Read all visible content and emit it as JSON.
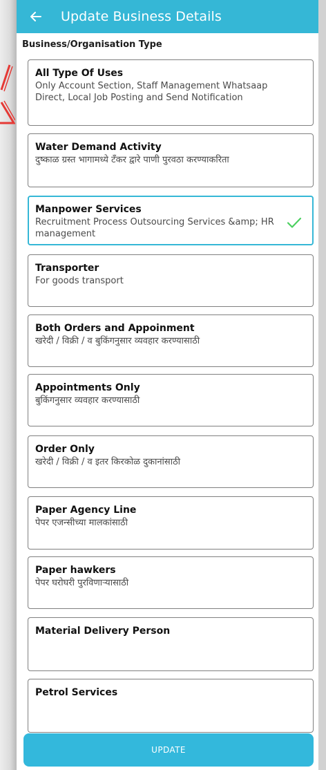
{
  "header": {
    "title": "Update Business Details",
    "back_icon": "arrow-left-icon"
  },
  "section": {
    "label": "Business/Organisation Type"
  },
  "business_types": [
    {
      "title": "All Type Of Uses",
      "description": "Only Account Section, Staff Management Whatsaap Direct, Local Job Posting and Send Notification",
      "selected": false
    },
    {
      "title": "Water Demand Activity",
      "description": "दुष्काळ ग्रस्त भागामध्ये टँकर द्वारे पाणी पुरवठा करण्याकरिता",
      "selected": false
    },
    {
      "title": "Manpower Services",
      "description": "Recruitment Process Outsourcing Services &amp; HR management",
      "selected": true
    },
    {
      "title": "Transporter",
      "description": "For goods transport",
      "selected": false
    },
    {
      "title": "Both Orders and Appoinment",
      "description": "खरेदी / विक्री / व बुकिंगनुसार व्यवहार करण्यासाठी",
      "selected": false
    },
    {
      "title": "Appointments Only",
      "description": "बुकिंगनुसार व्यवहार करण्यासाठी",
      "selected": false
    },
    {
      "title": "Order Only",
      "description": "खरेदी / विक्री / व इतर किरकोळ दुकानांसाठी",
      "selected": false
    },
    {
      "title": "Paper Agency Line",
      "description": "पेपर एजन्सीच्या मालकांसाठी",
      "selected": false
    },
    {
      "title": "Paper hawkers",
      "description": "पेपर घरोघरी पुरविणाऱ्यासाठी",
      "selected": false
    },
    {
      "title": "Material Delivery Person",
      "description": "",
      "selected": false
    },
    {
      "title": "Petrol Services",
      "description": "",
      "selected": false
    }
  ],
  "footer": {
    "update_label": "UPDATE"
  },
  "colors": {
    "accent": "#35b7d6",
    "check": "#4cd060",
    "card_border": "#7f7f7f"
  }
}
